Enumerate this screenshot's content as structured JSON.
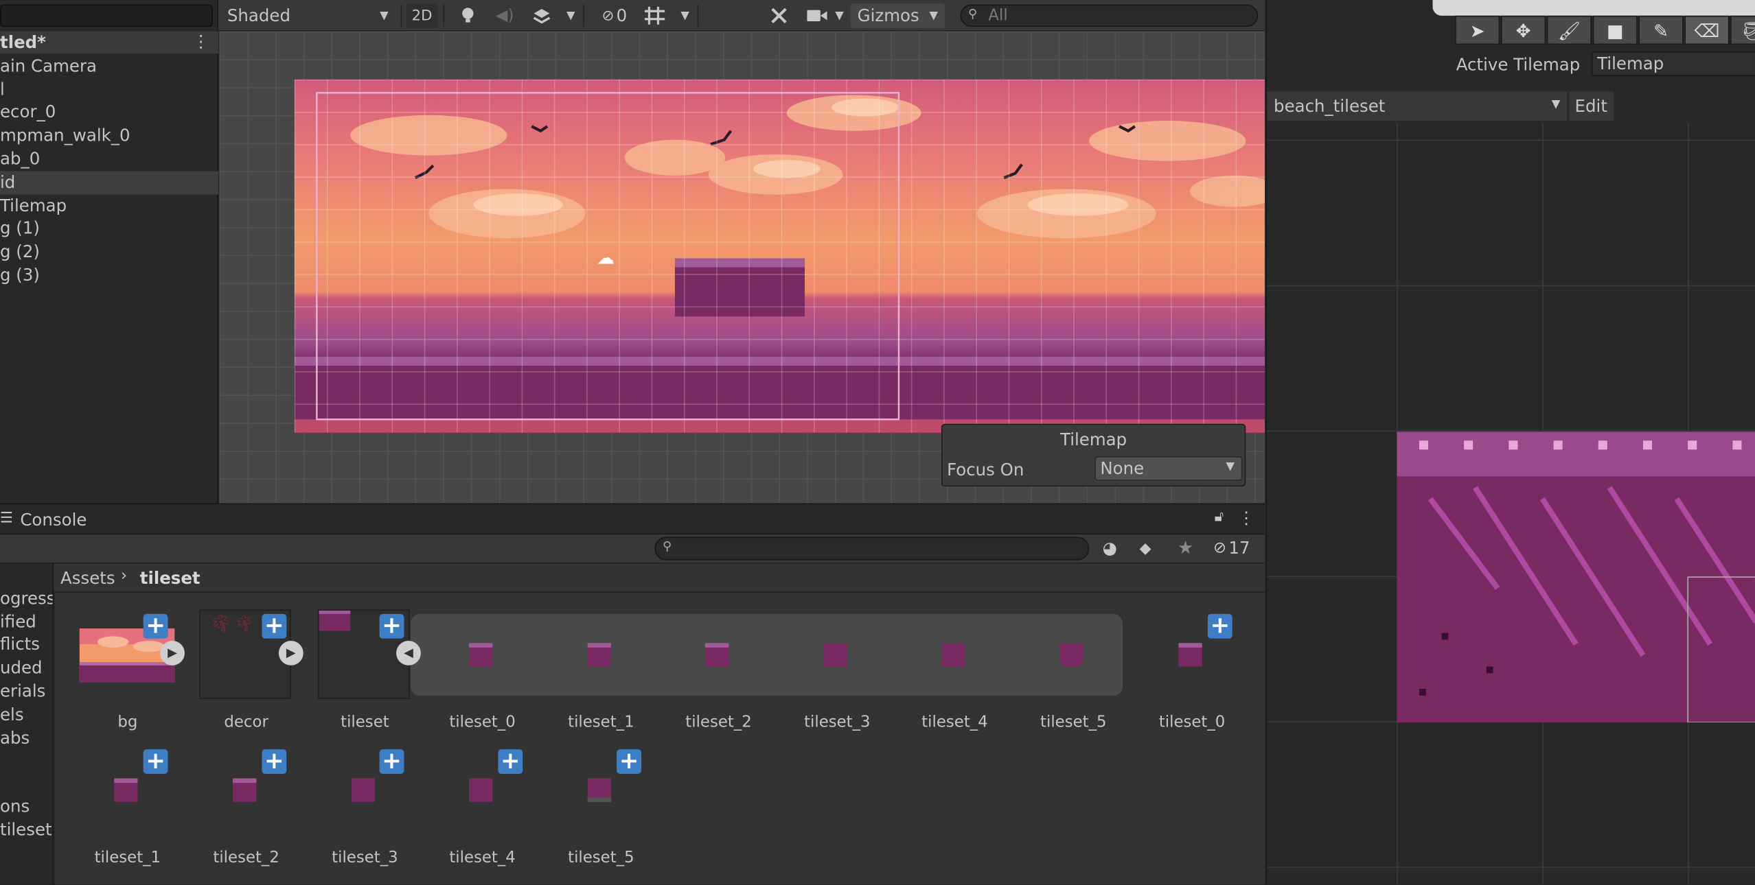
{
  "hierarchy": {
    "scene_title": "tled*",
    "items": [
      {
        "label": "ain Camera"
      },
      {
        "label": "l"
      },
      {
        "label": "ecor_0"
      },
      {
        "label": "mpman_walk_0"
      },
      {
        "label": "ab_0"
      },
      {
        "label": "id",
        "selected": true
      },
      {
        "label": " Tilemap"
      },
      {
        "label": "g (1)"
      },
      {
        "label": "g (2)"
      },
      {
        "label": "g (3)"
      }
    ]
  },
  "scene_toolbar": {
    "draw_mode": "Shaded",
    "mode_2d": "2D",
    "hidden_count": "0",
    "gizmos": "Gizmos",
    "search_placeholder": "All"
  },
  "tilemap_overlay": {
    "title": "Tilemap",
    "focus_label": "Focus On",
    "focus_value": "None"
  },
  "console": {
    "tab_label": "Console",
    "hidden_count": "17"
  },
  "project_left": {
    "items": [
      "ogress",
      "ified",
      "flicts",
      "uded",
      "erials",
      "els",
      "abs",
      "",
      "ons",
      "tileset"
    ]
  },
  "breadcrumb": {
    "root": "Assets",
    "current": "tileset"
  },
  "assets": {
    "row1": [
      "bg",
      "decor",
      "tileset",
      "tileset_0",
      "tileset_1",
      "tileset_2",
      "tileset_3",
      "tileset_4",
      "tileset_5",
      "tileset_0"
    ],
    "row2": [
      "tileset_1",
      "tileset_2",
      "tileset_3",
      "tileset_4",
      "tileset_5"
    ]
  },
  "palette": {
    "active_tilemap_label": "Active Tilemap",
    "active_tilemap_value": "Tilemap",
    "palette_name": "beach_tileset",
    "edit_label": "Edit"
  },
  "colors": {
    "accent_plus": "#3d7ec4",
    "tile_purple": "#7a2a63",
    "sky_orange": "#f29a6a"
  }
}
